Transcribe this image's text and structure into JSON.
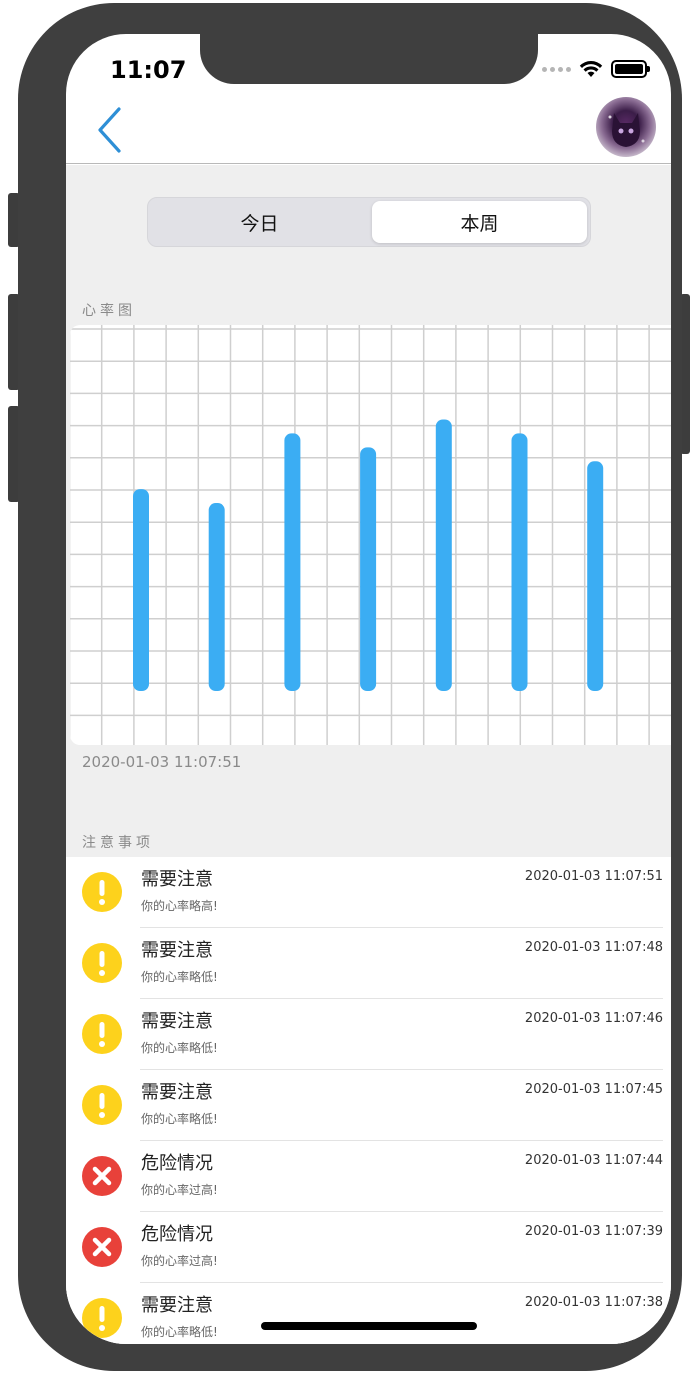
{
  "status_bar": {
    "time": "11:07"
  },
  "segmented": {
    "options": [
      "今日",
      "本周"
    ],
    "selected": 1
  },
  "chart": {
    "section_label": "心率图",
    "timestamp": "2020-01-03 11:07:51",
    "bar_color": "#3badf3",
    "grid_color": "#cfcfcf"
  },
  "chart_data": {
    "type": "bar",
    "categories": [
      "",
      "",
      "",
      "",
      "",
      "",
      ""
    ],
    "values": [
      14.5,
      13.5,
      18.5,
      17.5,
      19.5,
      18.5,
      16.5
    ],
    "ylim": [
      0,
      26
    ],
    "grid": true
  },
  "alerts": {
    "section_label": "注意事项",
    "items": [
      {
        "type": "warn",
        "icon": "exclamation-icon",
        "title": "需要注意",
        "subtitle": "你的心率略高!",
        "time": "2020-01-03 11:07:51"
      },
      {
        "type": "warn",
        "icon": "exclamation-icon",
        "title": "需要注意",
        "subtitle": "你的心率略低!",
        "time": "2020-01-03 11:07:48"
      },
      {
        "type": "warn",
        "icon": "exclamation-icon",
        "title": "需要注意",
        "subtitle": "你的心率略低!",
        "time": "2020-01-03 11:07:46"
      },
      {
        "type": "warn",
        "icon": "exclamation-icon",
        "title": "需要注意",
        "subtitle": "你的心率略低!",
        "time": "2020-01-03 11:07:45"
      },
      {
        "type": "danger",
        "icon": "cross-icon",
        "title": "危险情况",
        "subtitle": "你的心率过高!",
        "time": "2020-01-03 11:07:44"
      },
      {
        "type": "danger",
        "icon": "cross-icon",
        "title": "危险情况",
        "subtitle": "你的心率过高!",
        "time": "2020-01-03 11:07:39"
      },
      {
        "type": "warn",
        "icon": "exclamation-icon",
        "title": "需要注意",
        "subtitle": "你的心率略低!",
        "time": "2020-01-03 11:07:38"
      }
    ]
  },
  "colors": {
    "warn": "#fdd21c",
    "danger": "#e8413a",
    "accent": "#2e8fd6"
  }
}
